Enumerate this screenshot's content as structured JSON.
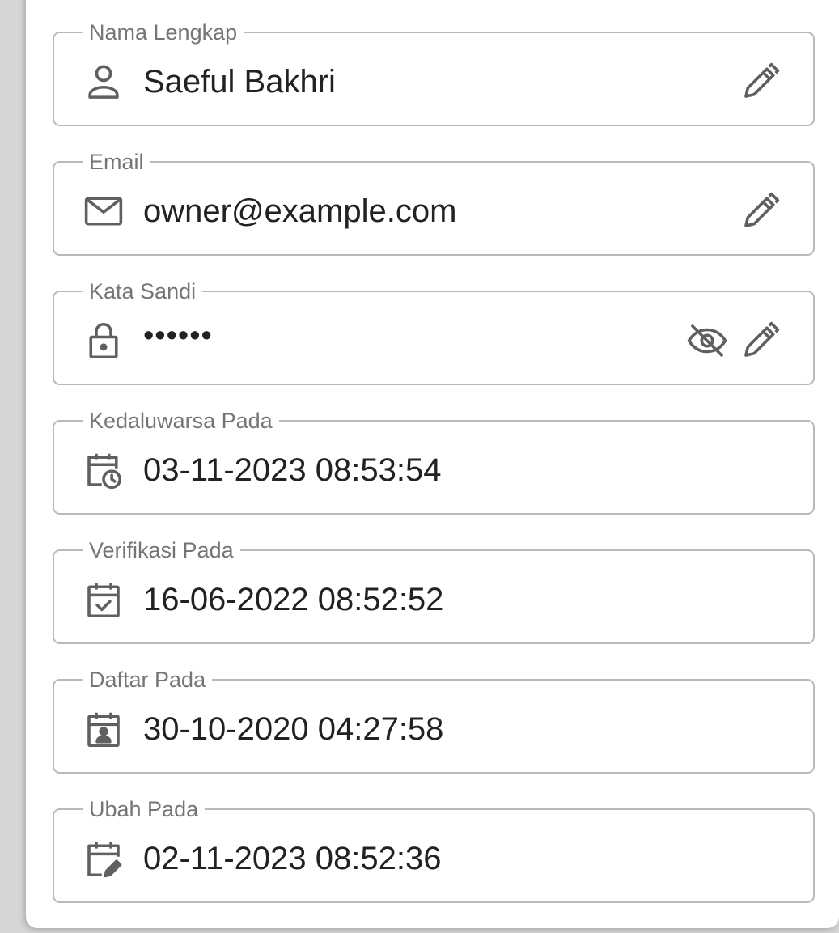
{
  "fields": [
    {
      "label": "Nama Lengkap",
      "value": "Saeful Bakhri",
      "icon": "person-icon",
      "actions": [
        "edit-icon"
      ]
    },
    {
      "label": "Email",
      "value": "owner@example.com",
      "icon": "mail-icon",
      "actions": [
        "edit-icon"
      ]
    },
    {
      "label": "Kata Sandi",
      "value": "••••••",
      "icon": "lock-icon",
      "actions": [
        "visibility-off-icon",
        "edit-icon"
      ]
    },
    {
      "label": "Kedaluwarsa Pada",
      "value": "03-11-2023 08:53:54",
      "icon": "calendar-clock-icon",
      "actions": []
    },
    {
      "label": "Verifikasi Pada",
      "value": "16-06-2022 08:52:52",
      "icon": "calendar-check-icon",
      "actions": []
    },
    {
      "label": "Daftar Pada",
      "value": "30-10-2020 04:27:58",
      "icon": "calendar-account-icon",
      "actions": []
    },
    {
      "label": "Ubah Pada",
      "value": "02-11-2023 08:52:36",
      "icon": "calendar-edit-icon",
      "actions": []
    }
  ],
  "colors": {
    "border": "#b9b9b9",
    "label": "#757575",
    "text": "#222222",
    "icon": "#606060"
  }
}
